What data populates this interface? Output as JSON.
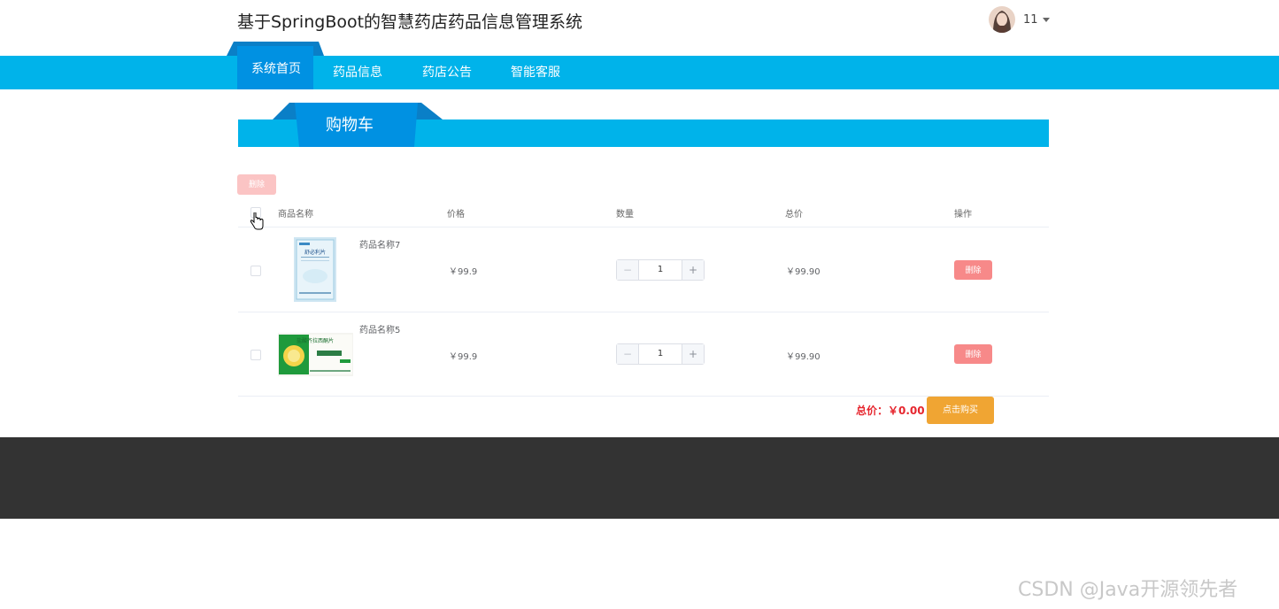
{
  "header": {
    "site_title": "基于SpringBoot的智慧药店药品信息管理系统",
    "user_name": "11"
  },
  "nav": {
    "items": [
      {
        "label": "系统首页",
        "active": true
      },
      {
        "label": "药品信息",
        "active": false
      },
      {
        "label": "药店公告",
        "active": false
      },
      {
        "label": "智能客服",
        "active": false
      }
    ]
  },
  "section": {
    "title": "购物车"
  },
  "toolbar": {
    "delete_label": "删除"
  },
  "table": {
    "columns": [
      "商品名称",
      "价格",
      "数量",
      "总价",
      "操作"
    ],
    "rows": [
      {
        "name": "药品名称7",
        "price": "￥99.9",
        "quantity": "1",
        "subtotal": "￥99.90",
        "action": "删除",
        "img_text": "舒必利片"
      },
      {
        "name": "药品名称5",
        "price": "￥99.9",
        "quantity": "1",
        "subtotal": "￥99.90",
        "action": "删除",
        "img_text": "盐酸齐拉西酮片"
      }
    ],
    "minus_symbol": "−",
    "plus_symbol": "+"
  },
  "summary": {
    "total_text": "总价：￥0.00",
    "buy_label": "点击购买"
  },
  "watermark": "CSDN @Java开源领先者",
  "colors": {
    "nav_bg": "#00b3ea",
    "nav_active": "#0091e2",
    "delete": "#f78989",
    "delete_disabled": "#fbc4c4",
    "buy": "#f0a533",
    "total": "#e6262e",
    "footer": "#333333"
  }
}
